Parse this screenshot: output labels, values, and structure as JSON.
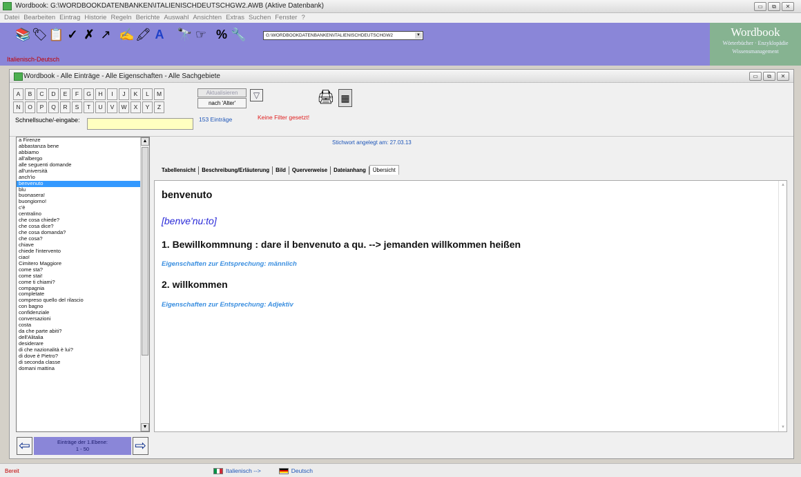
{
  "window": {
    "title": "Wordbook: G:\\WORDBOOKDATENBANKEN\\ITALIENISCHDEUTSCHGW2.AWB (Aktive Datenbank)"
  },
  "menu": [
    "Datei",
    "Bearbeiten",
    "Eintrag",
    "Historie",
    "Regeln",
    "Berichte",
    "Auswahl",
    "Ansichten",
    "Extras",
    "Suchen",
    "Fenster",
    "?"
  ],
  "toolbar": {
    "db_path": "G:\\WORDBOOKDATENBANKEN\\ITALIENISCHDEUTSCHGW2",
    "db_name": "Italienisch-Deutsch",
    "icons": [
      "books-icon",
      "tag-icon",
      "clipboard-icon",
      "check-icon",
      "x-icon",
      "arrow-icon",
      "pen-icon",
      "highlighter-icon",
      "font-icon",
      "binoculars-icon",
      "hand-icon",
      "percent-icon",
      "wrench-icon"
    ]
  },
  "brand": {
    "name": "Wordbook",
    "tagline1": "Wörterbücher · Enzyklopädie",
    "tagline2": "Wissensmanagement"
  },
  "inner": {
    "title": "Wordbook - Alle Einträge - Alle Eigenschaften - Alle Sachgebiete",
    "letters": [
      "A",
      "B",
      "C",
      "D",
      "E",
      "F",
      "G",
      "H",
      "I",
      "J",
      "K",
      "L",
      "M",
      "N",
      "O",
      "P",
      "Q",
      "R",
      "S",
      "T",
      "U",
      "V",
      "W",
      "X",
      "Y",
      "Z"
    ],
    "search_label": "Schnellsuche/-eingabe:",
    "search_value": "",
    "update_label": "Aktualisieren",
    "sort_label": "nach 'Alter'",
    "count": "153 Einträge",
    "filter_text": "Keine Filter gesetzt!"
  },
  "list": {
    "selected": "benvenuto",
    "items": [
      "a Firenze",
      "abbastanza bene",
      "abbiamo",
      "all'albergo",
      "alle seguenti domande",
      "all'università",
      "anch'io",
      "benvenuto",
      "blu",
      "buonasera!",
      "buongiorno!",
      "c'è",
      "centralino",
      "che cosa chiede?",
      "che cosa dice?",
      "che cosa domanda?",
      "che cosa?",
      "chiave",
      "chiede l'intervento",
      "ciao!",
      "Cimitero Maggiore",
      "come sta?",
      "come stai!",
      "come ti chiami?",
      "compagnia",
      "completate",
      "compreso quello del rilascio",
      "con bagno",
      "confidenziale",
      "conversazioni",
      "costa",
      "da che parte abiti?",
      "dell'Alitalia",
      "desiderare",
      "di che nazionalità è lui?",
      "di dove è Pietro?",
      "di seconda classe",
      "domani mattina"
    ],
    "nav_label1": "Einträge der 1.Ebene:",
    "nav_label2": "1 - 50"
  },
  "detail": {
    "created": "Stichwort angelegt am: 27.03.13",
    "tabs": [
      "Tabellensicht",
      "Beschreibung/Erläuterung",
      "Bild",
      "Querverweise",
      "Dateianhang",
      "Übersicht"
    ],
    "entry": "benvenuto",
    "phonetic": "[benve'nu:to]",
    "meaning1": "1. Bewillkommnung : dare il benvenuto a qu. --> jemanden willkommen heißen",
    "props1": "Eigenschaften zur Entsprechung: männlich",
    "meaning2": "2. willkommen",
    "props2": "Eigenschaften zur Entsprechung: Adjektiv"
  },
  "status": {
    "text": "Bereit",
    "lang_from": "Italienisch -->",
    "lang_to": "Deutsch"
  }
}
